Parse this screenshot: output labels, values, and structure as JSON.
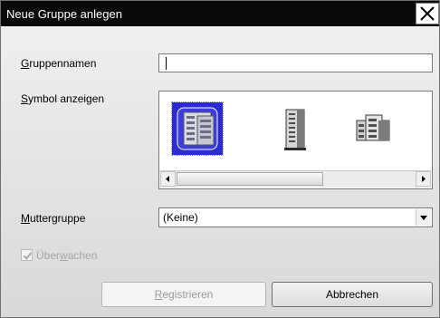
{
  "window": {
    "title": "Neue Gruppe anlegen"
  },
  "form": {
    "group_name": {
      "label_ul": "G",
      "label_rest": "ruppennamen",
      "value": ""
    },
    "symbol": {
      "label_ul": "S",
      "label_rest": "ymbol anzeigen",
      "icons": [
        "building-blue-icon",
        "building-tower-icon",
        "building-wide-icon"
      ],
      "selected_index": 0
    },
    "parent": {
      "label_ul": "M",
      "label_rest": "uttergruppe",
      "value": "(Keine)"
    },
    "monitor": {
      "label_pre": "Über",
      "label_ul": "w",
      "label_post": "achen",
      "checked": true,
      "enabled": false
    }
  },
  "buttons": {
    "register": {
      "label_ul": "R",
      "label_rest": "egistrieren",
      "enabled": false
    },
    "cancel": {
      "label": "Abbrechen"
    }
  }
}
